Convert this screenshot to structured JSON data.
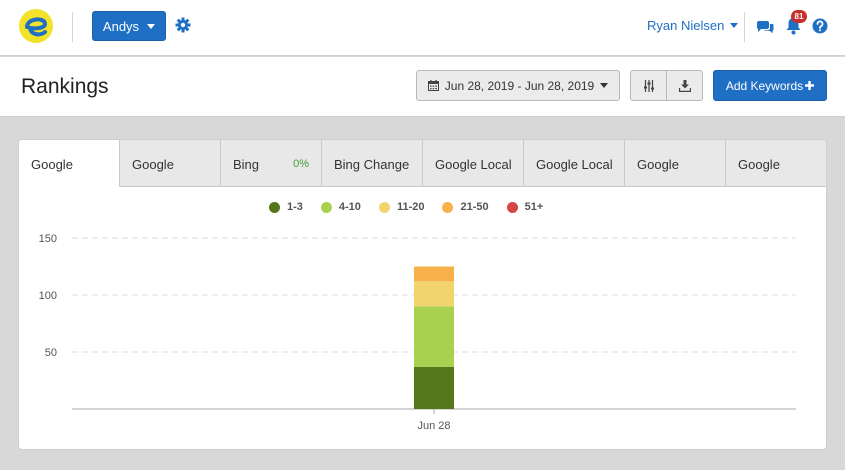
{
  "topbar": {
    "account_label": "Andys",
    "user_name": "Ryan Nielsen",
    "notification_count": "81"
  },
  "header": {
    "title": "Rankings",
    "date_range": "Jun 28, 2019 - Jun 28, 2019",
    "add_keywords_label": "Add Keywords"
  },
  "tabs": [
    {
      "label": "Google",
      "active": true
    },
    {
      "label": "Google"
    },
    {
      "label": "Bing",
      "extra": "0%"
    },
    {
      "label": "Bing Change"
    },
    {
      "label": "Google Local"
    },
    {
      "label": "Google Local"
    },
    {
      "label": "Google"
    },
    {
      "label": "Google"
    }
  ],
  "colors": {
    "accent": "#1f6fc5",
    "rank_1_3": "#55771b",
    "rank_4_10": "#a8d14f",
    "rank_11_20": "#f2d46f",
    "rank_21_50": "#f7b04a",
    "rank_51_plus": "#d54545"
  },
  "chart_data": {
    "type": "bar",
    "stacked": true,
    "categories": [
      "Jun 28"
    ],
    "series": [
      {
        "name": "1-3",
        "values": [
          37
        ],
        "color": "#55771b"
      },
      {
        "name": "4-10",
        "values": [
          53
        ],
        "color": "#a8d14f"
      },
      {
        "name": "11-20",
        "values": [
          22
        ],
        "color": "#f2d46f"
      },
      {
        "name": "21-50",
        "values": [
          13
        ],
        "color": "#f7b04a"
      },
      {
        "name": "51+",
        "values": [
          0
        ],
        "color": "#d54545"
      }
    ],
    "yticks": [
      "50",
      "100",
      "150"
    ],
    "ylim": [
      0,
      150
    ],
    "grid": true,
    "legend": "top-center"
  }
}
